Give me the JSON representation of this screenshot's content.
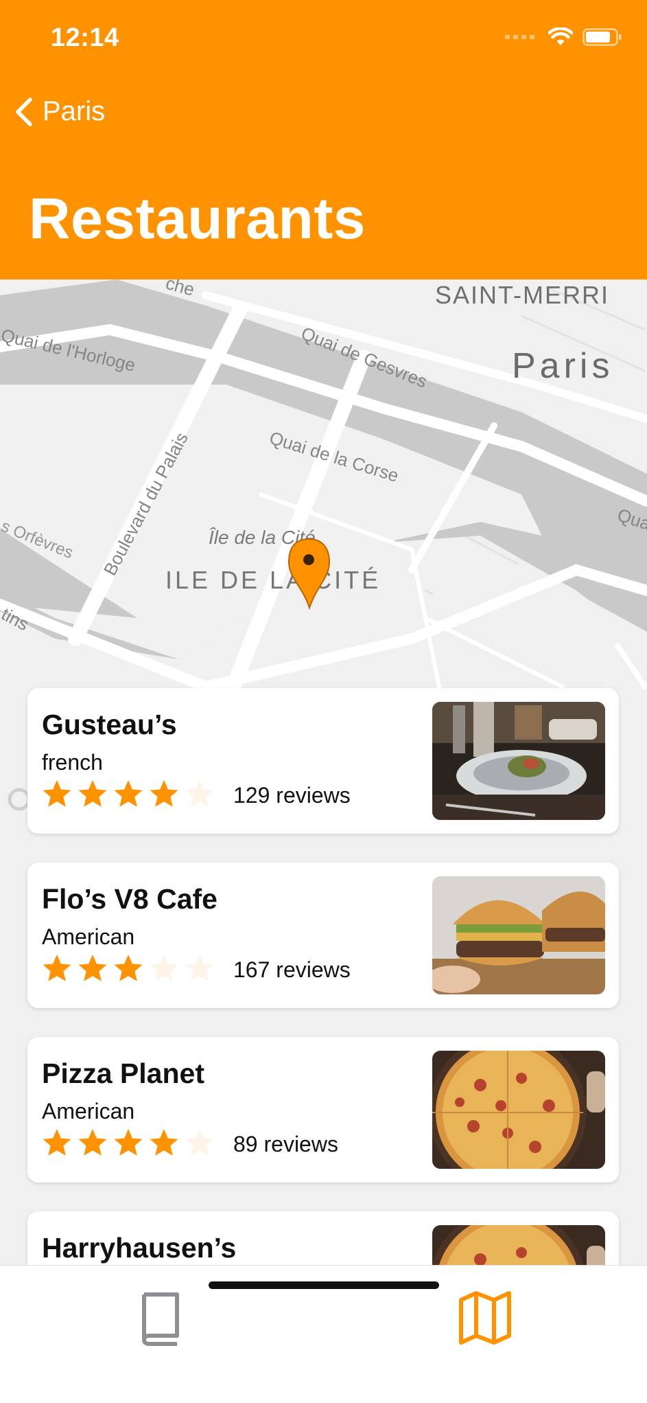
{
  "status_bar": {
    "time": "12:14"
  },
  "nav": {
    "back_label": "Paris",
    "title": "Restaurants"
  },
  "colors": {
    "accent": "#ff9200",
    "star_filled": "#ff9200",
    "star_empty": "#fff4e8",
    "tab_inactive": "#8e8e93"
  },
  "map": {
    "labels": {
      "saint_merri": "SAINT-MERRI",
      "paris": "Paris",
      "quai_horloge": "Quai de l'Horloge",
      "quai_gesvres": "Quai de Gesvres",
      "quai_corse": "Quai de la Corse",
      "boulevard_palais": "Boulevard du Palais",
      "ile_cite_small": "Île de la Cité",
      "ile_cite_big": "ILE DE LA CITÉ",
      "orfevres": "s Orfèvres",
      "quai_right": "Qua",
      "tins": "tins",
      "top_fragment": "che"
    }
  },
  "restaurants": [
    {
      "name": "Gusteau’s",
      "cuisine": "french",
      "rating": 4,
      "reviews": "129 reviews",
      "image": "plated-dish-photo"
    },
    {
      "name": "Flo’s V8 Cafe",
      "cuisine": "American",
      "rating": 3,
      "reviews": "167 reviews",
      "image": "burger-photo"
    },
    {
      "name": "Pizza Planet",
      "cuisine": "American",
      "rating": 4,
      "reviews": "89 reviews",
      "image": "pizza-photo"
    },
    {
      "name": "Harryhausen’s",
      "cuisine": "",
      "rating": 0,
      "reviews": "",
      "image": "pizza-photo"
    }
  ],
  "tab_bar": {
    "tabs": [
      {
        "icon": "book-icon",
        "selected": false
      },
      {
        "icon": "map-icon",
        "selected": true
      }
    ]
  }
}
